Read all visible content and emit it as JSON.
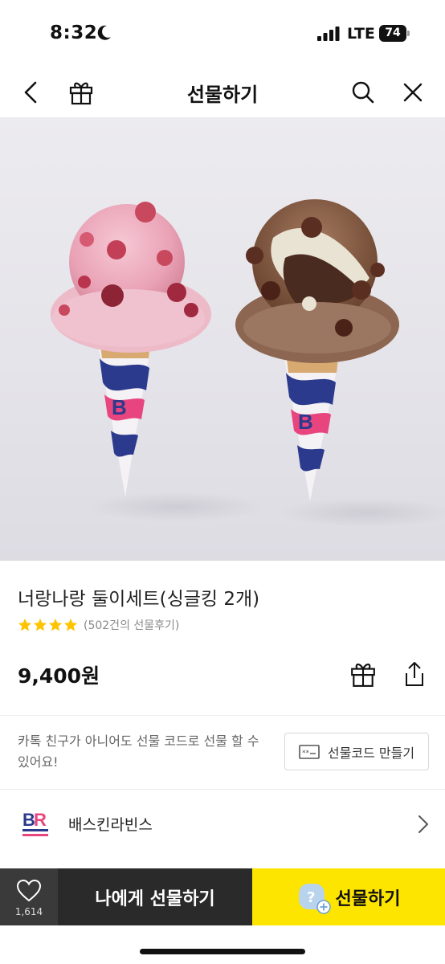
{
  "status": {
    "time": "8:32",
    "network": "LTE",
    "battery": "74"
  },
  "nav": {
    "title": "선물하기"
  },
  "product": {
    "title": "너랑나랑 둘이세트(싱글킹 2개)",
    "rating_stars": 4,
    "review_text": "(502건의 선물후기)",
    "price": "9,400원"
  },
  "gift_code": {
    "note": "카톡 친구가 아니어도 선물 코드로 선물 할 수 있어요!",
    "button_label": "선물코드 만들기"
  },
  "brand": {
    "name": "배스킨라빈스",
    "logo_text": "BR"
  },
  "bottom_bar": {
    "wish_count": "1,614",
    "gift_self_label": "나에게 선물하기",
    "gift_label": "선물하기"
  },
  "colors": {
    "accent_yellow": "#fee500",
    "star_yellow": "#ffc400",
    "brand_pink": "#e8457f",
    "brand_blue": "#2b3a8c"
  }
}
